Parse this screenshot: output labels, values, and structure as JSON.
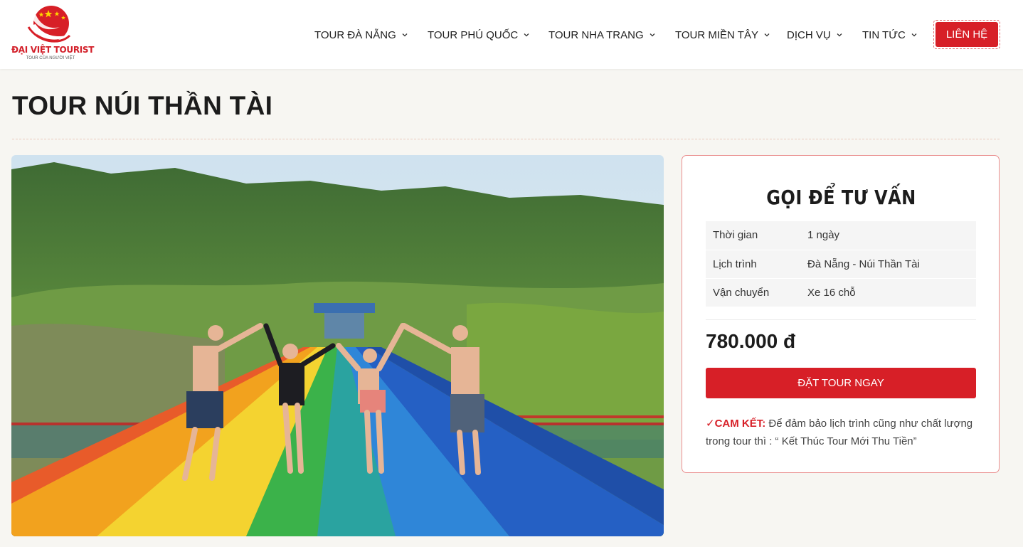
{
  "brand": {
    "name": "ĐẠI VIỆT TOURIST",
    "tagline": "TOUR CỦA NGƯỜI VIỆT",
    "primary_color": "#d71f27"
  },
  "nav": {
    "items": [
      {
        "label": "TOUR ĐÀ NẴNG",
        "icon": "chevron-down-icon"
      },
      {
        "label": "TOUR PHÚ QUỐC",
        "icon": "chevron-down-icon"
      },
      {
        "label": "TOUR NHA TRANG",
        "icon": "chevron-down-icon"
      },
      {
        "label": "TOUR MIỀN TÂY",
        "icon": "chevron-down-icon"
      },
      {
        "label": "DỊCH VỤ",
        "icon": "chevron-down-icon"
      },
      {
        "label": "TIN TỨC",
        "icon": "chevron-down-icon"
      }
    ],
    "contact_label": "LIÊN HỆ"
  },
  "page": {
    "title": "TOUR NÚI THẦN TÀI"
  },
  "card": {
    "title": "GỌI ĐỂ TƯ VẤN",
    "rows": [
      {
        "label": "Thời gian",
        "value": "1 ngày"
      },
      {
        "label": "Lịch trình",
        "value": "Đà Nẵng - Núi Thần Tài"
      },
      {
        "label": "Vận chuyển",
        "value": "Xe 16 chỗ"
      }
    ],
    "price": "780.000 đ",
    "book_label": "ĐẶT TOUR NGAY",
    "commit_label": "✓CAM KẾT:",
    "commit_text": "Để đảm bảo lịch trình cũng như chất lượng trong tour thì : “ Kết Thúc Tour Mới Thu Tiền”"
  }
}
